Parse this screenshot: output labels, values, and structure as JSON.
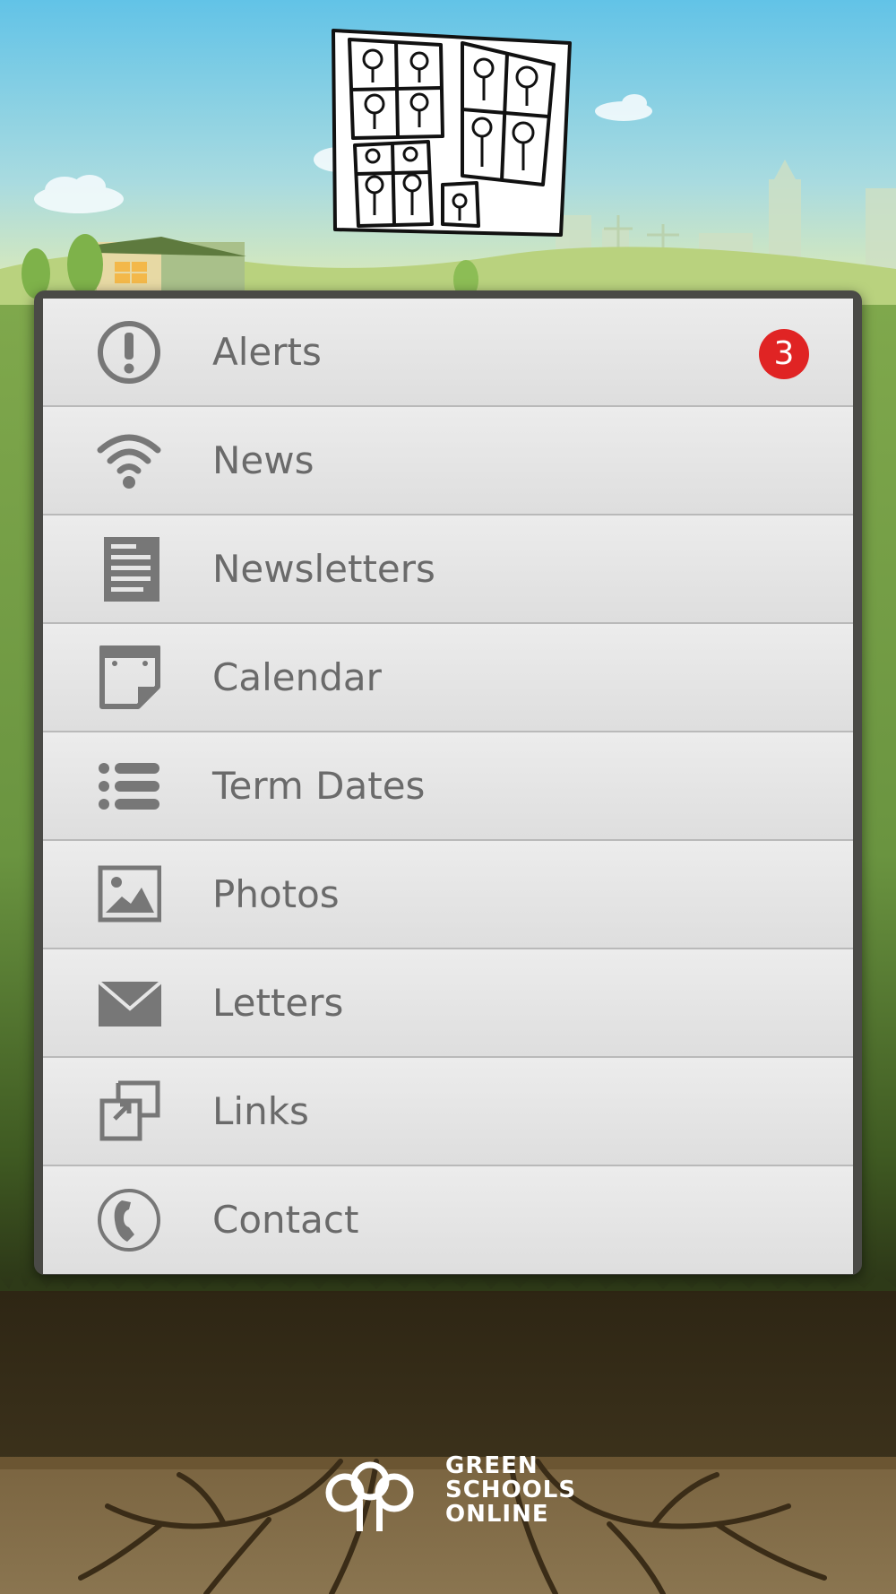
{
  "colors": {
    "sky_top": "#63c4e6",
    "sky_bottom": "#d8e9b0",
    "grass": "#6f9a44",
    "soil": "#3a2f19",
    "menu_bg": "#e6e6e6",
    "text": "#6a6a6a",
    "icon": "#777777",
    "badge": "#e02424"
  },
  "menu": {
    "items": [
      {
        "label": "Alerts",
        "icon": "exclamation-circle-icon",
        "badge": "3"
      },
      {
        "label": "News",
        "icon": "wifi-icon"
      },
      {
        "label": "Newsletters",
        "icon": "document-icon"
      },
      {
        "label": "Calendar",
        "icon": "calendar-icon"
      },
      {
        "label": "Term Dates",
        "icon": "list-icon"
      },
      {
        "label": "Photos",
        "icon": "image-icon"
      },
      {
        "label": "Letters",
        "icon": "envelope-icon"
      },
      {
        "label": "Links",
        "icon": "external-link-icon"
      },
      {
        "label": "Contact",
        "icon": "phone-icon"
      }
    ]
  },
  "brand": {
    "line1": "GREEN",
    "line2": "SCHOOLS",
    "line3": "ONLINE"
  }
}
